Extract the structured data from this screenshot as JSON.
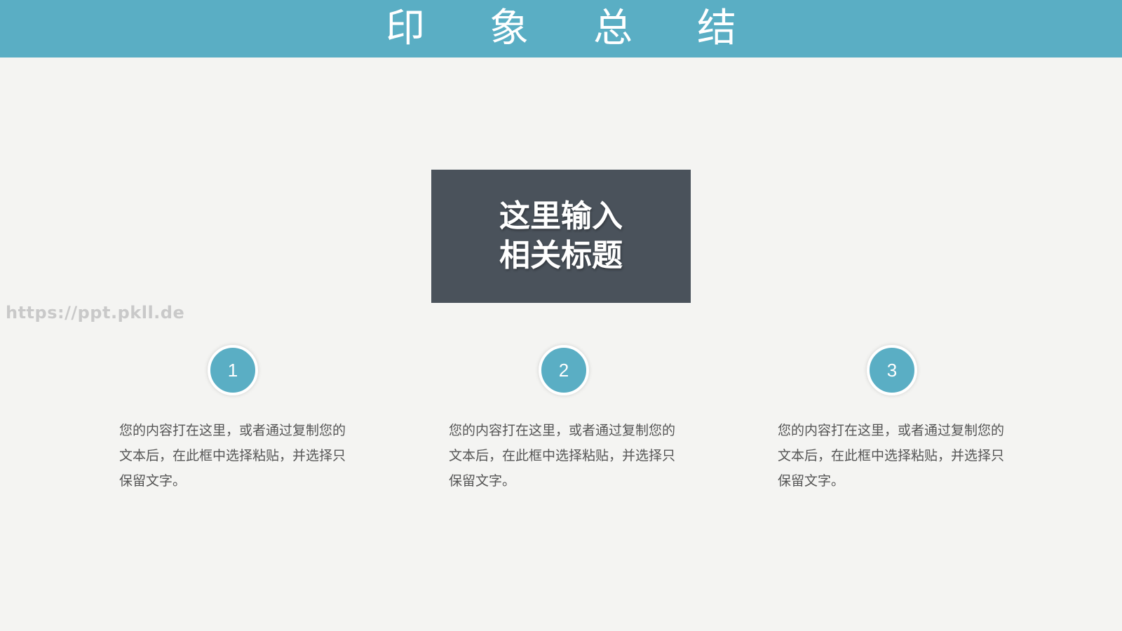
{
  "header": {
    "title": "印象总结"
  },
  "watermark": "https://ppt.pkll.de",
  "heading_box": {
    "line1": "这里输入",
    "line2": "相关标题"
  },
  "items": [
    {
      "number": "1",
      "text": "您的内容打在这里，或者通过复制您的文本后，在此框中选择粘贴，并选择只保留文字。"
    },
    {
      "number": "2",
      "text": "您的内容打在这里，或者通过复制您的文本后，在此框中选择粘贴，并选择只保留文字。"
    },
    {
      "number": "3",
      "text": "您的内容打在这里，或者通过复制您的文本后，在此框中选择粘贴，并选择只保留文字。"
    }
  ],
  "colors": {
    "accent": "#5aaec4",
    "heading_box": "#4a525b",
    "background": "#f4f4f2",
    "body_text": "#555555"
  }
}
